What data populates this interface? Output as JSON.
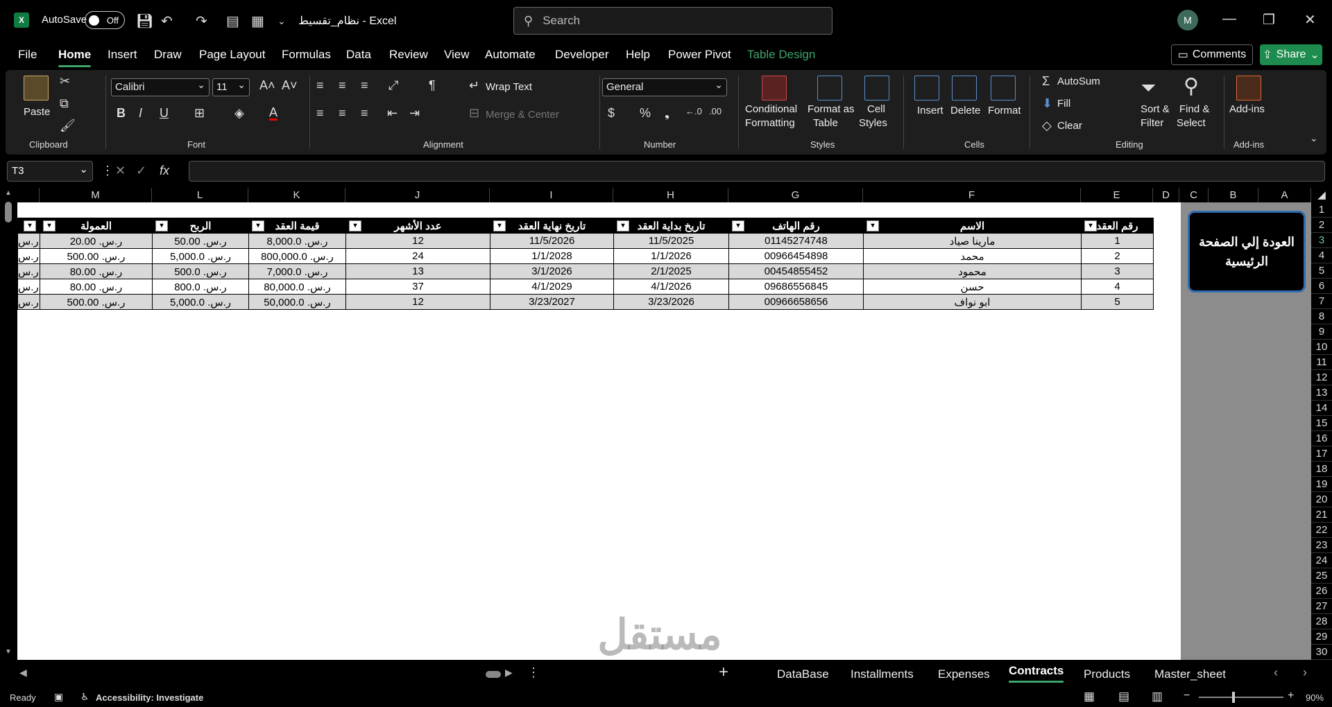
{
  "titlebar": {
    "autosave_label": "AutoSave",
    "autosave_state": "Off",
    "doc_title": "نظام_تقسيط  -  Excel",
    "search_placeholder": "Search",
    "avatar_initial": "M"
  },
  "menu": {
    "items": [
      "File",
      "Home",
      "Insert",
      "Draw",
      "Page Layout",
      "Formulas",
      "Data",
      "Review",
      "View",
      "Automate",
      "Developer",
      "Help",
      "Power Pivot",
      "Table Design"
    ],
    "active": "Home",
    "comments_label": "Comments",
    "share_label": "Share"
  },
  "ribbon": {
    "clipboard": {
      "paste": "Paste",
      "label": "Clipboard"
    },
    "font": {
      "name": "Calibri",
      "size": "11",
      "label": "Font"
    },
    "alignment": {
      "wrap": "Wrap Text",
      "merge": "Merge & Center",
      "label": "Alignment"
    },
    "number": {
      "format": "General",
      "label": "Number"
    },
    "styles": {
      "cond1": "Conditional",
      "cond2": "Formatting",
      "fmt1": "Format as",
      "fmt2": "Table",
      "cell1": "Cell",
      "cell2": "Styles",
      "label": "Styles"
    },
    "cells": {
      "insert": "Insert",
      "delete": "Delete",
      "format": "Format",
      "label": "Cells"
    },
    "editing": {
      "autosum": "AutoSum",
      "fill": "Fill",
      "clear": "Clear",
      "sort1": "Sort &",
      "sort2": "Filter",
      "find1": "Find &",
      "find2": "Select",
      "label": "Editing"
    },
    "addins": {
      "btn": "Add-ins",
      "label": "Add-ins"
    }
  },
  "formula_bar": {
    "name_box": "T3",
    "fx": "fx",
    "value": ""
  },
  "columns": [
    "M",
    "L",
    "K",
    "J",
    "I",
    "H",
    "G",
    "F",
    "E",
    "D",
    "C",
    "B",
    "A"
  ],
  "rows": [
    "1",
    "2",
    "3",
    "4",
    "5",
    "6",
    "7",
    "8",
    "9",
    "10",
    "11",
    "12",
    "13",
    "14",
    "15",
    "16",
    "17",
    "18",
    "19",
    "20",
    "21",
    "22",
    "23",
    "24",
    "25",
    "26",
    "27",
    "28",
    "29",
    "30"
  ],
  "selected_row": "3",
  "back_button": "العودة إلي الصفحة الرئيسية",
  "table": {
    "headers": [
      "رقم العقد",
      "الاسم",
      "رقم الهاتف",
      "تاريخ بداية العقد",
      "تاريخ نهاية العقد",
      "عدد الأشهر",
      "قيمة العقد",
      "الربح",
      "العمولة"
    ],
    "rows": [
      [
        "1",
        "مارينا صياد",
        "01145274748",
        "11/5/2025",
        "11/5/2026",
        "12",
        "ر.س. 8,000.0",
        "ر.س. 50.00",
        "ر.س. 20.00",
        "ر.س"
      ],
      [
        "2",
        "محمد",
        "00966454898",
        "1/1/2026",
        "1/1/2028",
        "24",
        "ر.س. 800,000.0",
        "ر.س. 5,000.0",
        "ر.س. 500.00",
        "ر.س"
      ],
      [
        "3",
        "محمود",
        "00454855452",
        "2/1/2025",
        "3/1/2026",
        "13",
        "ر.س. 7,000.0",
        "ر.س. 500.0",
        "ر.س. 80.00",
        "ر.س"
      ],
      [
        "4",
        "حسن",
        "09686556845",
        "4/1/2026",
        "4/1/2029",
        "37",
        "ر.س. 80,000.0",
        "ر.س. 800.0",
        "ر.س. 80.00",
        "ر.س"
      ],
      [
        "5",
        "ابو نواف",
        "00966658656",
        "3/23/2026",
        "3/23/2027",
        "12",
        "ر.س. 50,000.0",
        "ر.س. 5,000.0",
        "ر.س. 500.00",
        "ر.س"
      ]
    ]
  },
  "sheets": {
    "tabs": [
      "DataBase",
      "Installments",
      "Expenses",
      "Contracts",
      "Products",
      "Master_sheet"
    ],
    "active": "Contracts"
  },
  "status": {
    "ready": "Ready",
    "accessibility": "Accessibility: Investigate",
    "zoom": "90%"
  },
  "watermark": {
    "line1": "مستقل",
    "line2": "mostaql.com"
  }
}
